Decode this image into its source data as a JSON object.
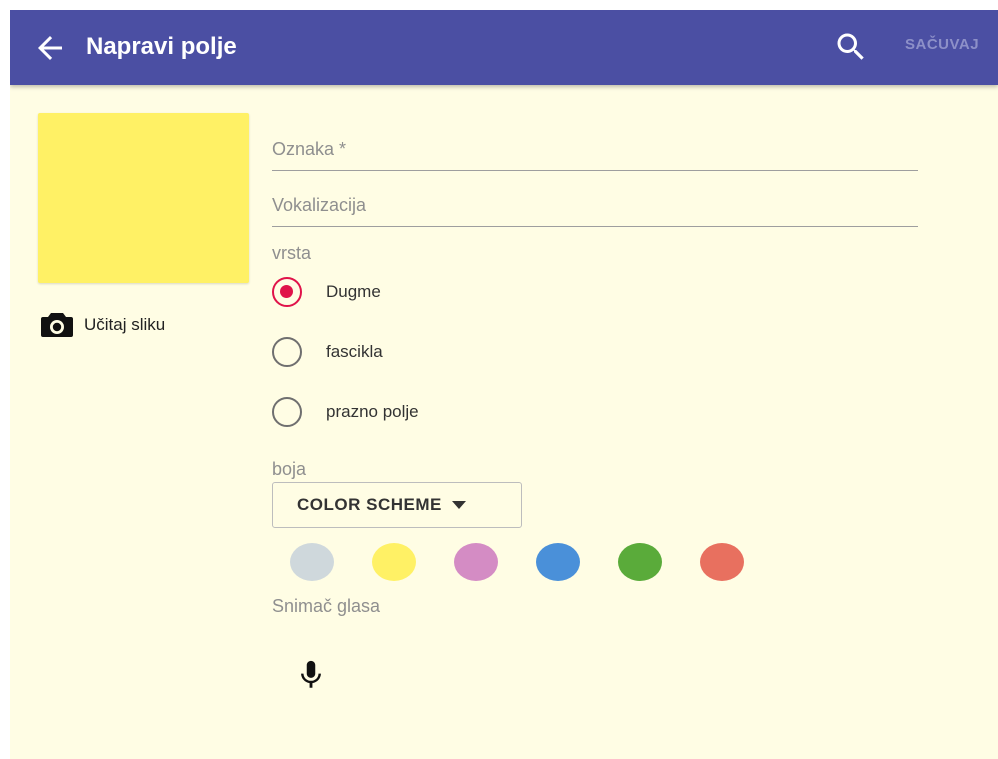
{
  "appbar": {
    "title": "Napravi polje",
    "back_icon": "arrow-left-icon",
    "search_icon": "search-icon",
    "save_label": "SAČUVAJ",
    "background": "#4b4fa3"
  },
  "preview": {
    "tile_color": "#fff165",
    "load_image_label": "Učitaj sliku",
    "load_image_icon": "camera-icon"
  },
  "form": {
    "label_placeholder": "Oznaka *",
    "label_value": "",
    "vocalization_placeholder": "Vokalizacija",
    "vocalization_value": "",
    "type_label": "vrsta",
    "type_options": [
      {
        "label": "Dugme",
        "checked": true
      },
      {
        "label": "fascikla",
        "checked": false
      },
      {
        "label": "prazno polje",
        "checked": false
      }
    ],
    "color_label": "boja",
    "color_scheme_label": "COLOR SCHEME",
    "swatches": [
      "#cfd8dc",
      "#fff165",
      "#d48cc4",
      "#4a90d9",
      "#5aab3a",
      "#e8705f"
    ],
    "voice_recorder_label": "Snimač glasa",
    "mic_icon": "microphone-icon"
  },
  "colors": {
    "page_background": "#fffde4",
    "radio_accent": "#e0134a"
  }
}
